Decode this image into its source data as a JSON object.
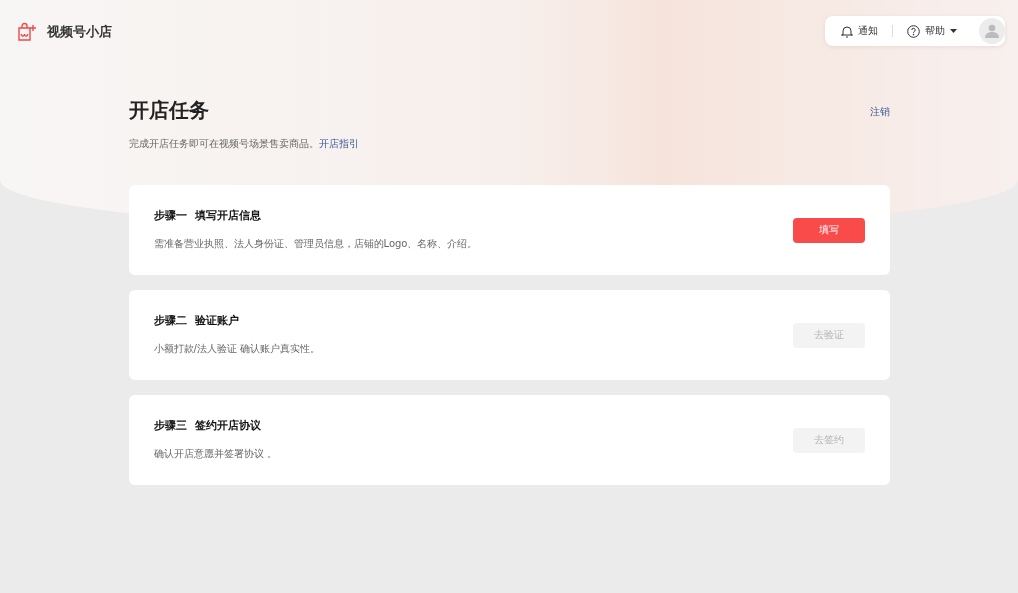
{
  "header": {
    "brand": "视频号小店",
    "notifications": "通知",
    "help": "帮助"
  },
  "page": {
    "title": "开店任务",
    "subtitle": "完成开店任务即可在视频号场景售卖商品。",
    "guide_link": "开店指引",
    "logout": "注销"
  },
  "steps": [
    {
      "step": "步骤一",
      "title": "填写开店信息",
      "description": "需准备营业执照、法人身份证、管理员信息，店铺的Logo、名称、介绍。",
      "button": "填写",
      "disabled": false
    },
    {
      "step": "步骤二",
      "title": "验证账户",
      "description": "小额打款/法人验证 确认账户真实性。",
      "button": "去验证",
      "disabled": true
    },
    {
      "step": "步骤三",
      "title": "签约开店协议",
      "description": "确认开店意愿并签署协议 。",
      "button": "去签约",
      "disabled": true
    }
  ]
}
